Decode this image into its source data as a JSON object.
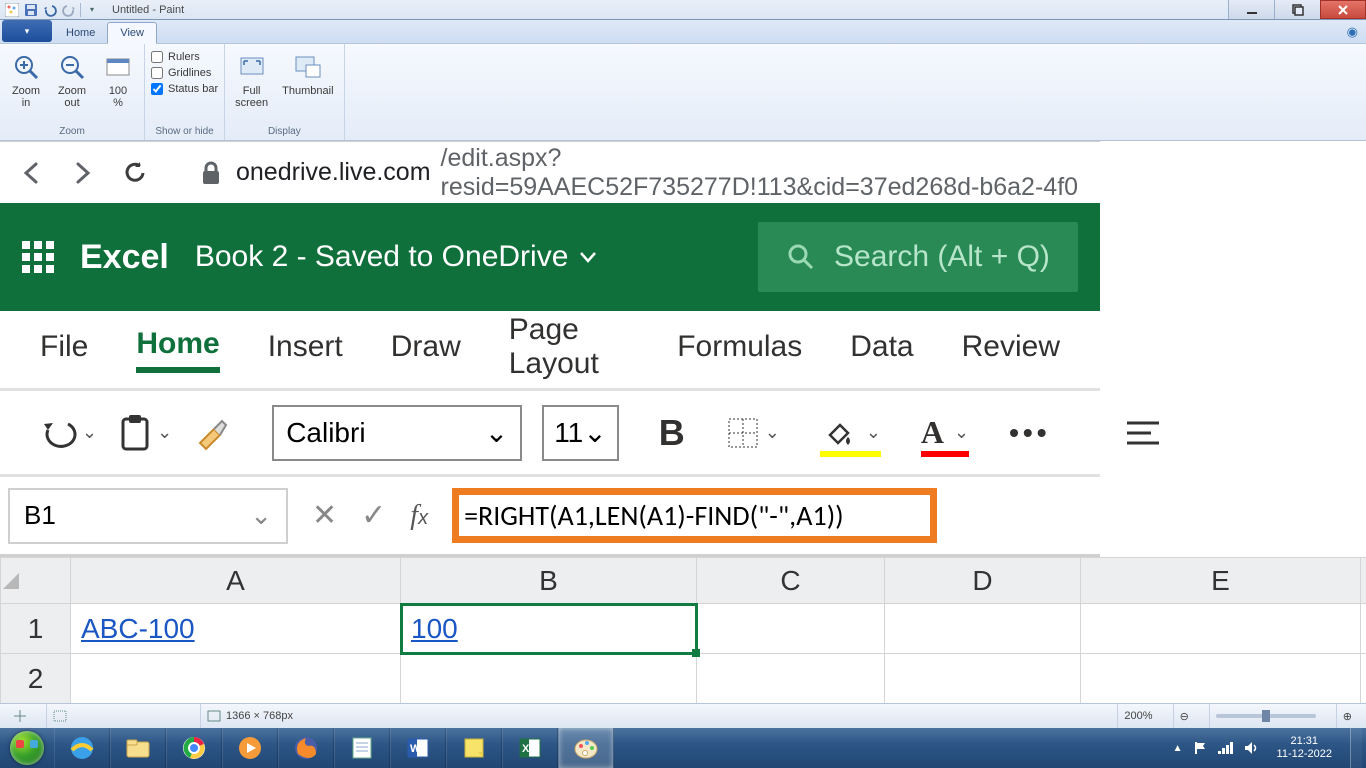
{
  "paint": {
    "title": "Untitled - Paint",
    "tabs": {
      "file": "",
      "home": "Home",
      "view": "View"
    },
    "ribbon": {
      "zoom": {
        "label": "Zoom",
        "zoom_in": "Zoom\nin",
        "zoom_out": "Zoom\nout",
        "hundred": "100\n%"
      },
      "show": {
        "label": "Show or hide",
        "rulers": "Rulers",
        "gridlines": "Gridlines",
        "statusbar": "Status bar"
      },
      "display": {
        "label": "Display",
        "full": "Full\nscreen",
        "thumb": "Thumbnail"
      }
    },
    "status": {
      "size": "1366 × 768px",
      "zoom": "200%"
    }
  },
  "browser": {
    "url_host": "onedrive.live.com",
    "url_path": "/edit.aspx?resid=59AAEC52F735277D!113&cid=37ed268d-b6a2-4f0"
  },
  "excel": {
    "brand": "Excel",
    "doc": "Book 2  -  Saved to OneDrive",
    "search_placeholder": "Search (Alt + Q)",
    "tabs": [
      "File",
      "Home",
      "Insert",
      "Draw",
      "Page Layout",
      "Formulas",
      "Data",
      "Review"
    ],
    "active_tab_index": 1,
    "toolbar": {
      "font": "Calibri",
      "size": "11"
    },
    "name_box": "B1",
    "formula": "=RIGHT(A1,LEN(A1)-FIND(\"-\",A1))",
    "columns": [
      "A",
      "B",
      "C",
      "D",
      "E"
    ],
    "rows": [
      {
        "num": "1",
        "cells": {
          "A": "ABC-100",
          "B": "100"
        }
      },
      {
        "num": "2",
        "cells": {}
      }
    ],
    "selected_cell": "B1"
  },
  "taskbar": {
    "time": "21:31",
    "date": "11-12-2022"
  }
}
